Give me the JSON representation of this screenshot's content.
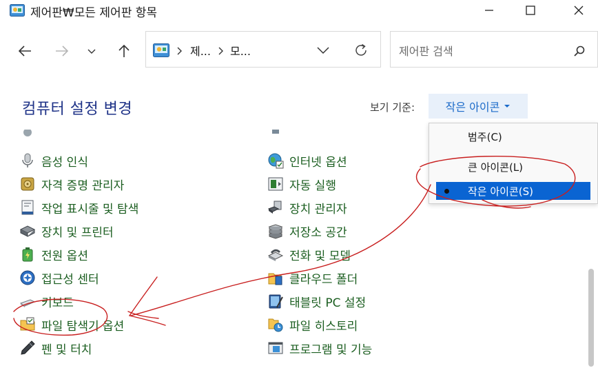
{
  "window": {
    "title": "제어판₩모든 제어판 항목"
  },
  "address_bar": {
    "crumbs": [
      "제...",
      "모..."
    ]
  },
  "search": {
    "placeholder": "제어판 검색"
  },
  "page": {
    "heading": "컴퓨터 설정 변경",
    "view_by_label": "보기 기준:",
    "view_by_value": "작은 아이콘"
  },
  "view_menu": {
    "items": [
      "범주(C)",
      "큰 아이콘(L)",
      "작은 아이콘(S)"
    ],
    "selected": "작은 아이콘(S)"
  },
  "left_items": [
    {
      "label": "음성 인식",
      "icon": "microphone-icon"
    },
    {
      "label": "자격 증명 관리자",
      "icon": "credential-vault-icon"
    },
    {
      "label": "작업 표시줄 및 탐색",
      "icon": "taskbar-icon"
    },
    {
      "label": "장치 및 프린터",
      "icon": "printer-icon"
    },
    {
      "label": "전원 옵션",
      "icon": "power-battery-icon"
    },
    {
      "label": "접근성 센터",
      "icon": "accessibility-icon"
    },
    {
      "label": "키보드",
      "icon": "keyboard-icon"
    },
    {
      "label": "파일 탐색기 옵션",
      "icon": "folder-options-icon"
    },
    {
      "label": "펜 및 터치",
      "icon": "pen-icon"
    }
  ],
  "right_items": [
    {
      "label": "인터넷 옵션",
      "icon": "globe-icon"
    },
    {
      "label": "자동 실행",
      "icon": "autoplay-icon"
    },
    {
      "label": "장치 관리자",
      "icon": "device-manager-icon"
    },
    {
      "label": "저장소 공간",
      "icon": "storage-spaces-icon"
    },
    {
      "label": "전화 및 모뎀",
      "icon": "phone-modem-icon"
    },
    {
      "label": "클라우드 폴더",
      "icon": "cloud-folder-icon"
    },
    {
      "label": "태블릿 PC 설정",
      "icon": "tablet-icon"
    },
    {
      "label": "파일 히스토리",
      "icon": "file-history-icon"
    },
    {
      "label": "프로그램 및 기능",
      "icon": "programs-icon"
    }
  ],
  "colors": {
    "heading": "#1e3287",
    "link": "#1b5e20",
    "accent": "#0a64d2",
    "annotation": "#c81e1e"
  }
}
